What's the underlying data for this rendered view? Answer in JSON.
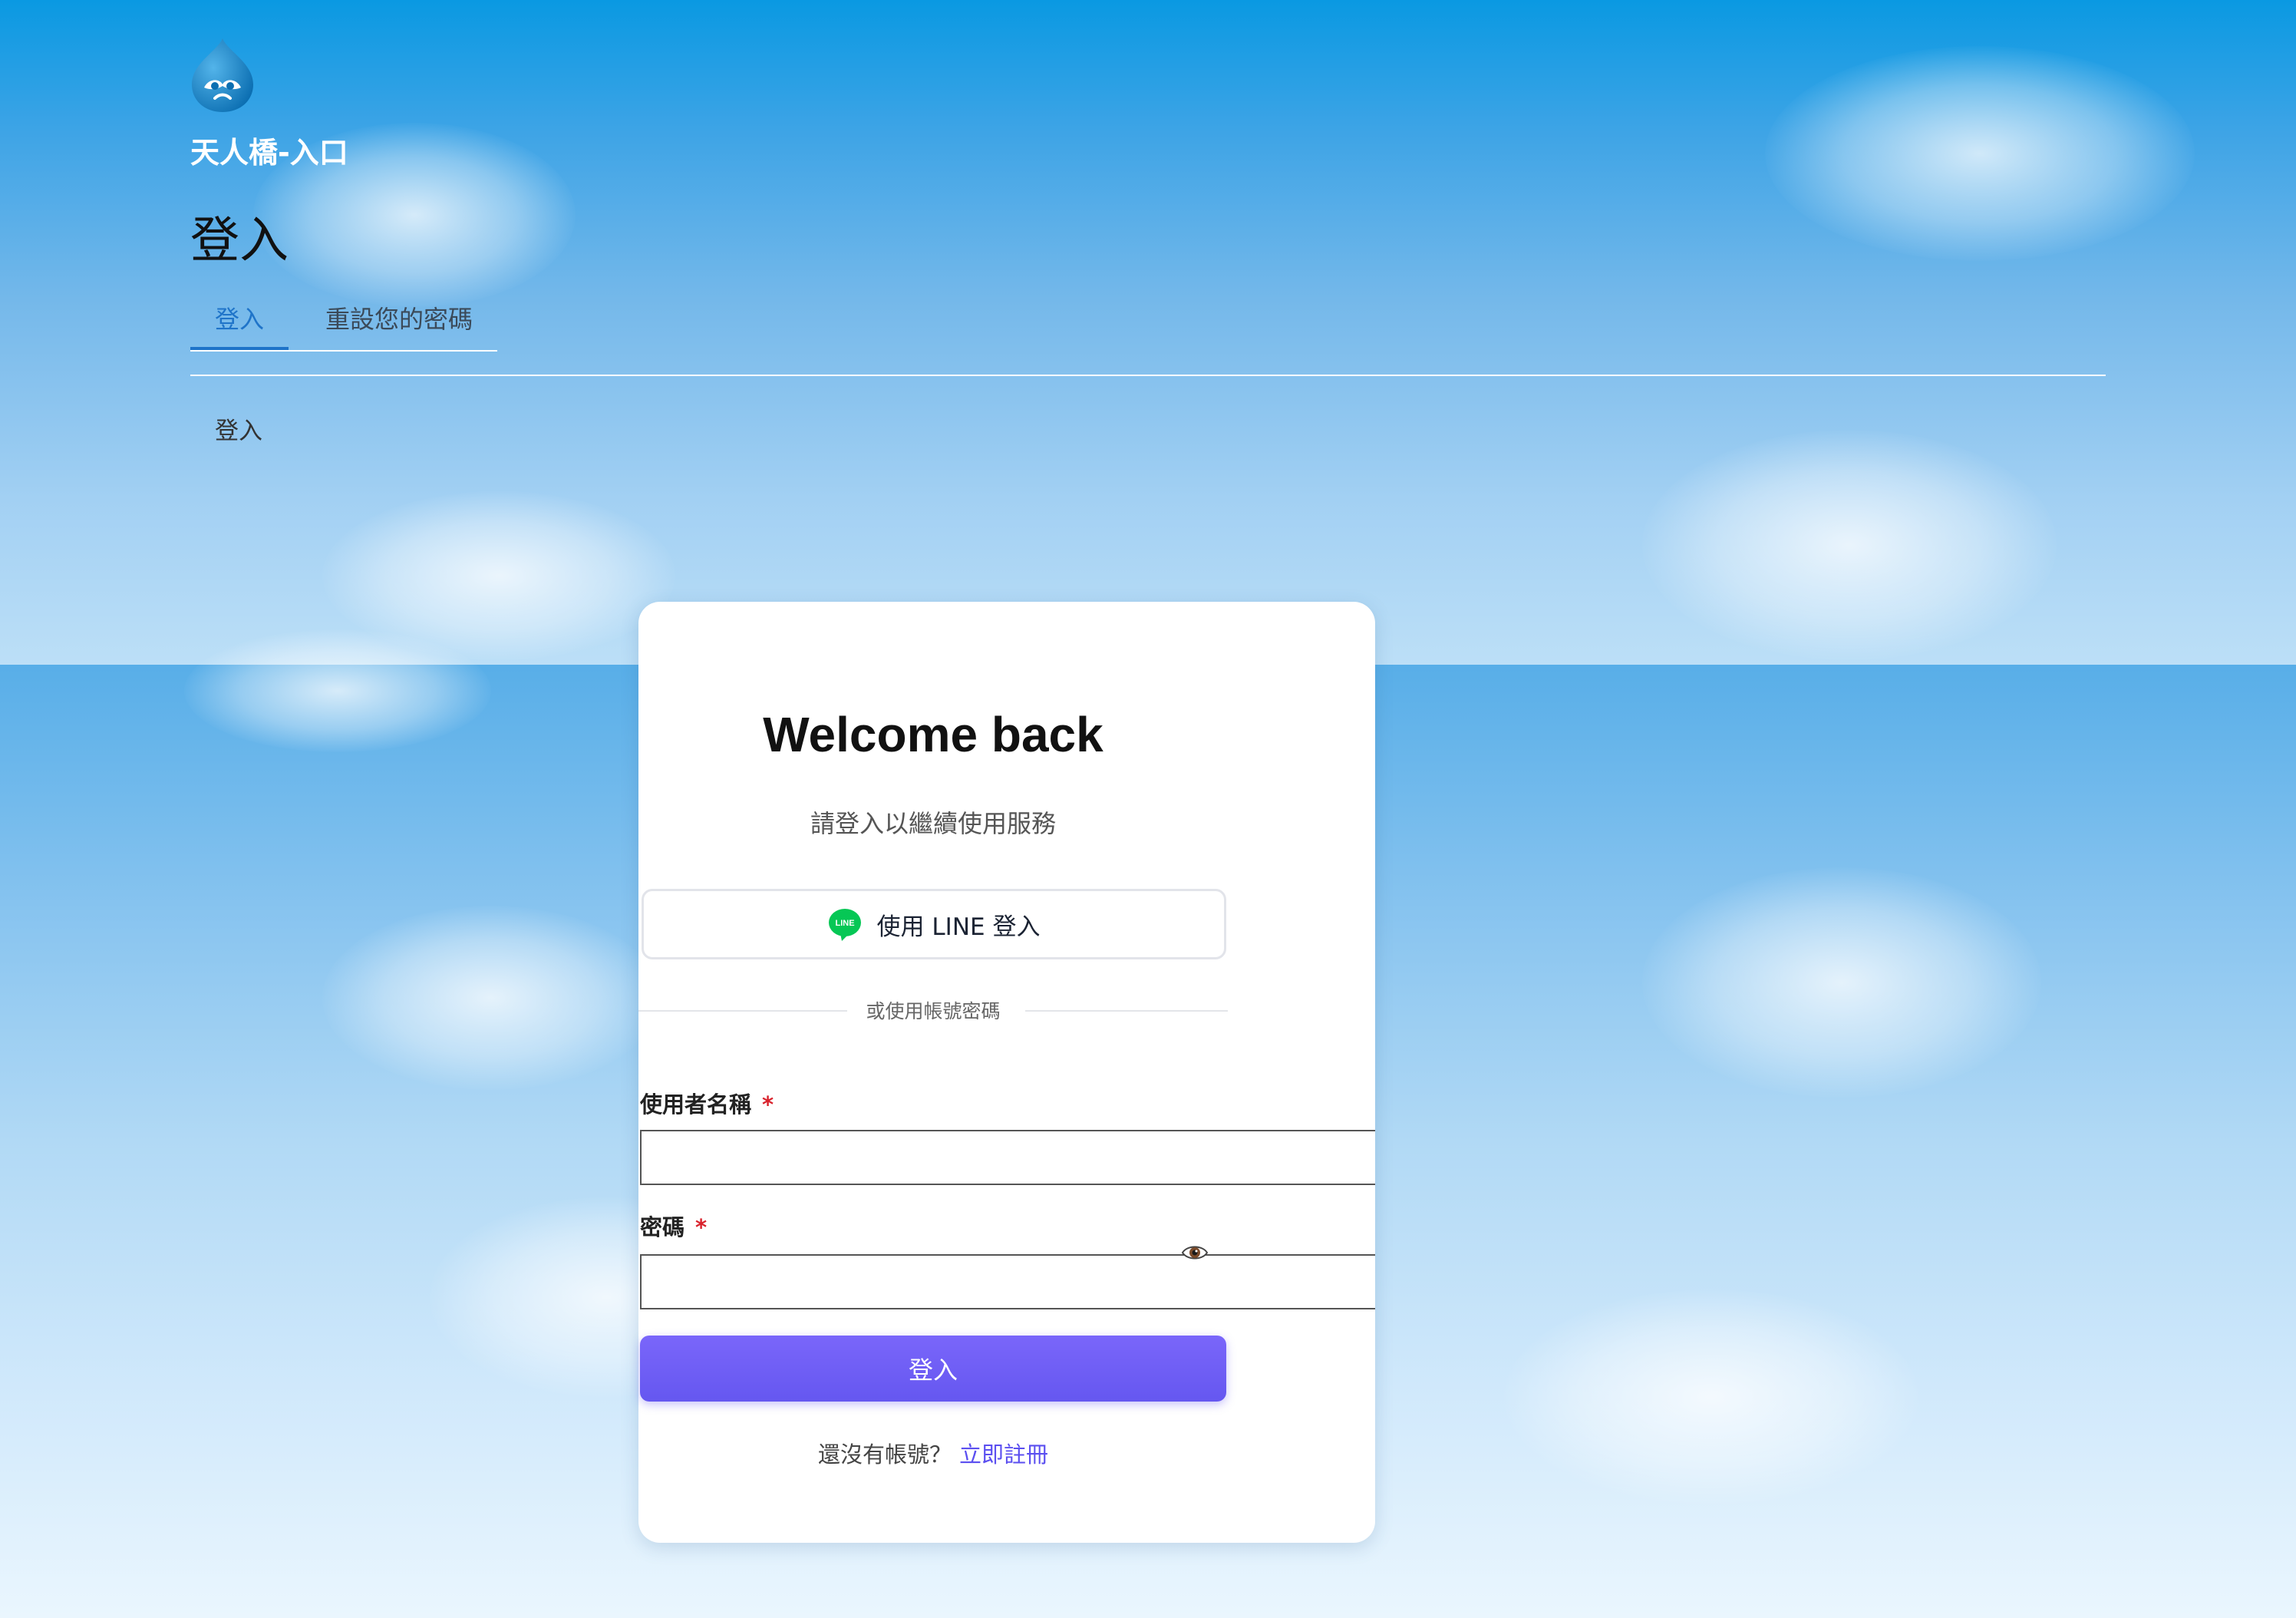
{
  "site": {
    "name": "天人橋-入口",
    "logo_icon": "drupal-drop-logo"
  },
  "page": {
    "title": "登入"
  },
  "tabs": [
    {
      "label": "登入",
      "active": true
    },
    {
      "label": "重設您的密碼",
      "active": false
    }
  ],
  "breadcrumb": "登入",
  "card": {
    "heading": "Welcome back",
    "subtitle": "請登入以繼續使用服務",
    "line_button": {
      "label": "使用 LINE 登入",
      "icon": "line-icon",
      "icon_text": "LINE"
    },
    "divider_text": "或使用帳號密碼",
    "username": {
      "label": "使用者名稱",
      "required_mark": "*",
      "value": ""
    },
    "password": {
      "label": "密碼",
      "required_mark": "*",
      "value": "",
      "toggle_icon": "eye-icon"
    },
    "submit_label": "登入",
    "register": {
      "prompt": "還沒有帳號？",
      "link": "立即註冊"
    }
  },
  "colors": {
    "accent": "#1f74c9",
    "button": "#6b5cf6",
    "line_green": "#06c755",
    "required": "#d9232d"
  }
}
